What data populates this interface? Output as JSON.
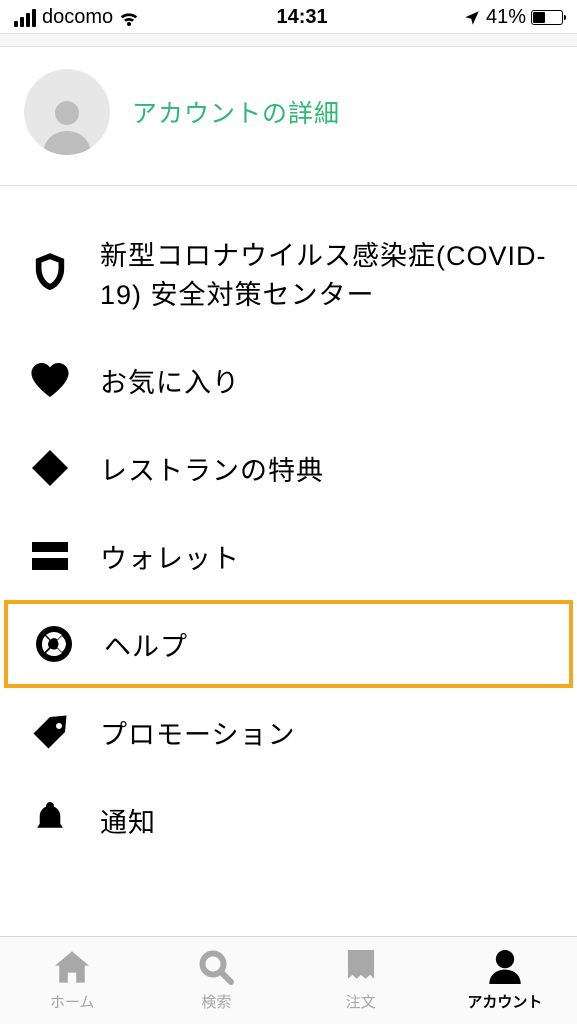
{
  "status": {
    "carrier": "docomo",
    "time": "14:31",
    "battery_pct": "41%",
    "battery_level": 41
  },
  "profile": {
    "link_label": "アカウントの詳細"
  },
  "menu": [
    {
      "label": "新型コロナウイルス感染症(COVID-19) 安全対策センター",
      "icon": "shield-icon"
    },
    {
      "label": "お気に入り",
      "icon": "heart-icon"
    },
    {
      "label": "レストランの特典",
      "icon": "diamond-icon"
    },
    {
      "label": "ウォレット",
      "icon": "wallet-icon"
    },
    {
      "label": "ヘルプ",
      "icon": "lifebuoy-icon",
      "highlighted": true
    },
    {
      "label": "プロモーション",
      "icon": "tag-icon"
    },
    {
      "label": "通知",
      "icon": "bell-icon"
    }
  ],
  "tabs": [
    {
      "label": "ホーム",
      "icon": "home-icon",
      "active": false
    },
    {
      "label": "検索",
      "icon": "search-icon",
      "active": false
    },
    {
      "label": "注文",
      "icon": "receipt-icon",
      "active": false
    },
    {
      "label": "アカウント",
      "icon": "person-icon",
      "active": true
    }
  ],
  "colors": {
    "accent_green": "#2db974",
    "highlight_orange": "#f3a81d"
  }
}
